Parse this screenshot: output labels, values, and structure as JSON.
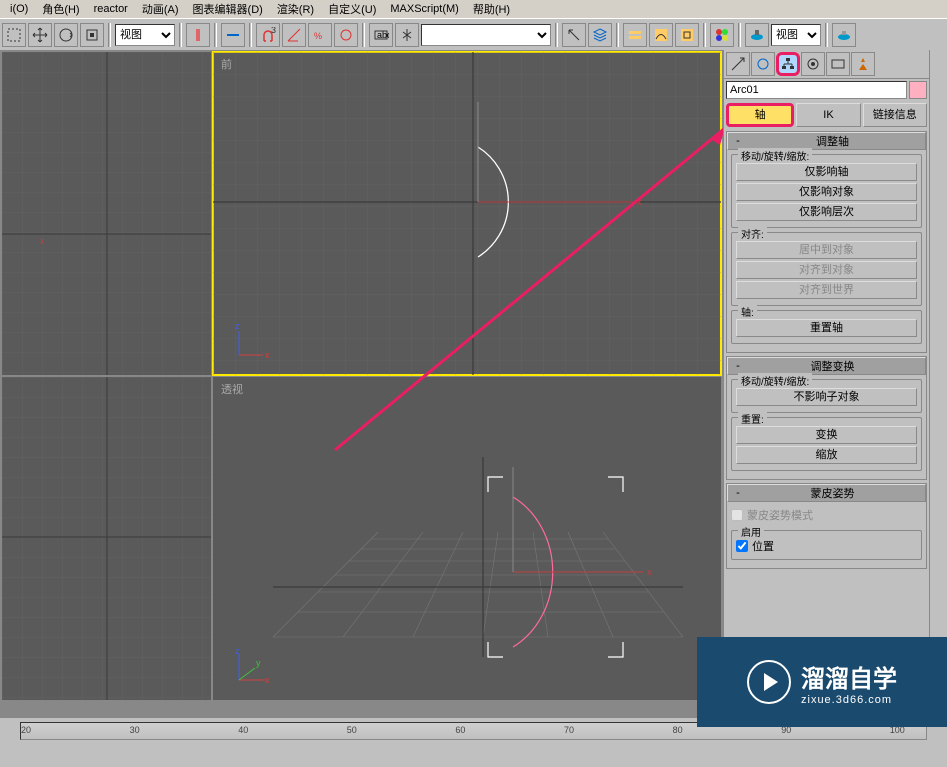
{
  "menu": {
    "items": [
      "i(O)",
      "角色(H)",
      "reactor",
      "动画(A)",
      "图表编辑器(D)",
      "渲染(R)",
      "自定义(U)",
      "MAXScript(M)",
      "帮助(H)"
    ]
  },
  "toolbar": {
    "select1": "视图",
    "select2": "",
    "select3": "视图"
  },
  "viewports": {
    "front_label": "前",
    "persp_label": "透视",
    "axis_x": "x",
    "axis_y": "y",
    "axis_z": "z"
  },
  "panel": {
    "object_name": "Arc01",
    "tabs": {
      "axis": "轴",
      "ik": "IK",
      "link": "链接信息"
    },
    "rollout1": {
      "title": "调整轴",
      "group1_label": "移动/旋转/缩放:",
      "btn_affect_axis": "仅影响轴",
      "btn_affect_obj": "仅影响对象",
      "btn_affect_hier": "仅影响层次",
      "group2_label": "对齐:",
      "btn_center_obj": "居中到对象",
      "btn_align_obj": "对齐到对象",
      "btn_align_world": "对齐到世界",
      "group3_label": "轴:",
      "btn_reset_axis": "重置轴"
    },
    "rollout2": {
      "title": "调整变换",
      "group1_label": "移动/旋转/缩放:",
      "btn_no_affect": "不影响子对象",
      "group2_label": "重置:",
      "btn_transform": "变换",
      "btn_scale": "缩放"
    },
    "rollout3": {
      "title": "蒙皮姿势",
      "mode_label": "蒙皮姿势模式",
      "group_label": "启用",
      "check_pos": "位置"
    }
  },
  "ruler": {
    "ticks": [
      20,
      30,
      40,
      50,
      60,
      70,
      80,
      90,
      100
    ]
  },
  "watermark": {
    "text": "溜溜自学",
    "sub": "zixue.3d66.com"
  }
}
